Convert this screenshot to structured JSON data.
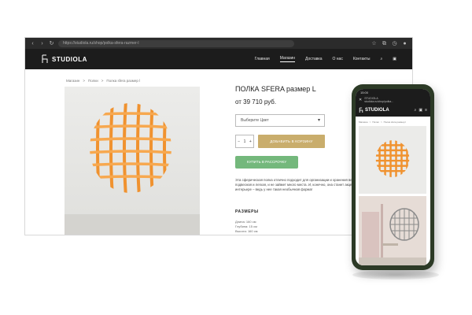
{
  "browser": {
    "url": "https://studiola.ru/shop/polka-sfera-razmer-l"
  },
  "site": {
    "logo_text": "STUDIOLA",
    "nav": [
      "Главная",
      "Магазин",
      "Доставка",
      "О нас",
      "Контакты"
    ],
    "active_nav": "Магазин"
  },
  "breadcrumb": [
    "Магазин",
    "Полки",
    "Полка sfera размер l"
  ],
  "product": {
    "title": "ПОЛКА SFERA размер L",
    "price": "от  39 710 руб.",
    "color_select": "Выберите Цвет",
    "qty": "1",
    "cart_button": "ДОБАВИТЬ В КОРЗИНУ",
    "credit_button": "КУПИТЬ В РАССРОЧКУ",
    "description_1": "Эта сферическая полка отлично подходит для организации и хранения вещей. Она",
    "description_2": "подвесная и легкая, и не займет много места. И, конечно, она станет акцентом в",
    "description_3": "интерьере – ведь у нее такая необычная форма!",
    "sizes_heading": "РАЗМЕРЫ",
    "sizes": [
      "Длина: 160 см",
      "Глубина: 15 см",
      "Высота: 160 см"
    ]
  },
  "phone": {
    "status": "15:00",
    "url_line1": "STUDIOLA",
    "url_line2": "studiola.ru/shop/polka...",
    "logo_text": "STUDIOLA",
    "breadcrumb": [
      "Магазин",
      "Полки",
      "Полка sfera размер l"
    ]
  },
  "colors": {
    "header_bg": "#1c1c1c",
    "accent_gold": "#c9ad6c",
    "accent_green": "#74b87c",
    "shelf_orange": "#f39a3c",
    "phone_body": "#2c3a26"
  }
}
